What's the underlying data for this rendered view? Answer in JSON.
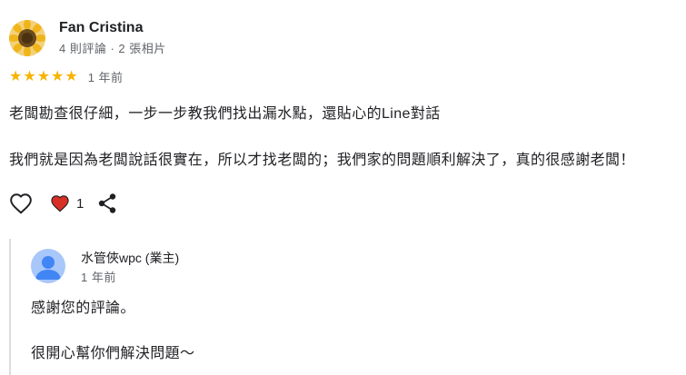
{
  "review": {
    "reviewer_name": "Fan Cristina",
    "reviewer_meta": "4 則評論 · 2 張相片",
    "rating": 5,
    "rating_max": 5,
    "star_icon": "star-icon",
    "time": "1 年前",
    "paragraphs": [
      "老闆勘查很仔細，一步一步教我們找出漏水點，還貼心的Line對話",
      "我們就是因為老闆說話很實在，所以才找老闆的；我們家的問題順利解決了，真的很感謝老闆！"
    ]
  },
  "actions": {
    "like_icon": "heart-outline-icon",
    "reaction_icon": "heart-filled-icon",
    "reaction_count": "1",
    "share_icon": "share-icon"
  },
  "owner_reply": {
    "name": "水管俠wpc (業主)",
    "time": "1 年前",
    "paragraphs": [
      "感謝您的評論。",
      "很開心幫你們解決問題～"
    ]
  },
  "colors": {
    "star": "#f6b400",
    "heart": "#d93025",
    "owner_avatar_bg": "#a8c7fa",
    "owner_avatar_fg": "#4285f4",
    "divider": "#dadce0"
  }
}
